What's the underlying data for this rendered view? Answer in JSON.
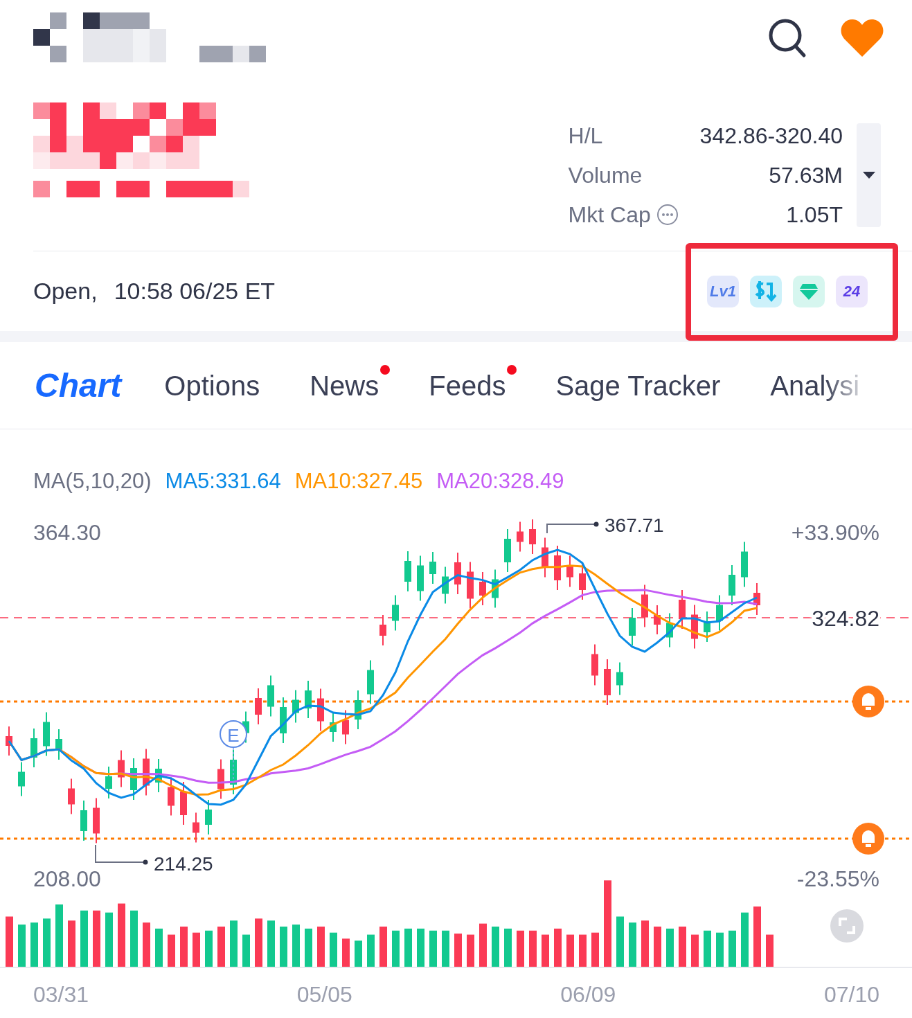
{
  "stats": [
    {
      "label": "H/L",
      "value": "342.86-320.40",
      "kind": "plain"
    },
    {
      "label": "Volume",
      "value": "57.63M",
      "kind": "plain"
    },
    {
      "label": "Mkt Cap",
      "value": "1.05T",
      "kind": "info"
    }
  ],
  "status": {
    "state": "Open,",
    "time": "10:58 06/25 ET"
  },
  "badges": [
    {
      "kind": "level",
      "text": "Lv1"
    },
    {
      "kind": "dollar"
    },
    {
      "kind": "diamond"
    },
    {
      "kind": "hours",
      "text": "24"
    }
  ],
  "tabs": [
    {
      "label": "Chart",
      "selected": true,
      "dot": false
    },
    {
      "label": "Options",
      "selected": false,
      "dot": false
    },
    {
      "label": "News",
      "selected": false,
      "dot": true
    },
    {
      "label": "Feeds",
      "selected": false,
      "dot": true
    },
    {
      "label": "Sage Tracker",
      "selected": false,
      "dot": false
    },
    {
      "label": "Analysi",
      "selected": false,
      "dot": false
    }
  ],
  "legend": {
    "label": "MA(5,10,20)",
    "series": [
      {
        "text": "MA5:331.64",
        "color": "#0a8ae6"
      },
      {
        "text": "MA10:327.45",
        "color": "#ff9500"
      },
      {
        "text": "MA20:328.49",
        "color": "#c45cf5"
      }
    ]
  },
  "chart": {
    "price_high": "364.30",
    "price_low": "208.00",
    "pct_high": "+33.90%",
    "pct_low": "-23.55%",
    "current": "324.82",
    "max_marker": "367.71",
    "min_marker": "214.25",
    "event": "E"
  },
  "dates": [
    "03/31",
    "05/05",
    "06/09",
    "07/10"
  ]
}
